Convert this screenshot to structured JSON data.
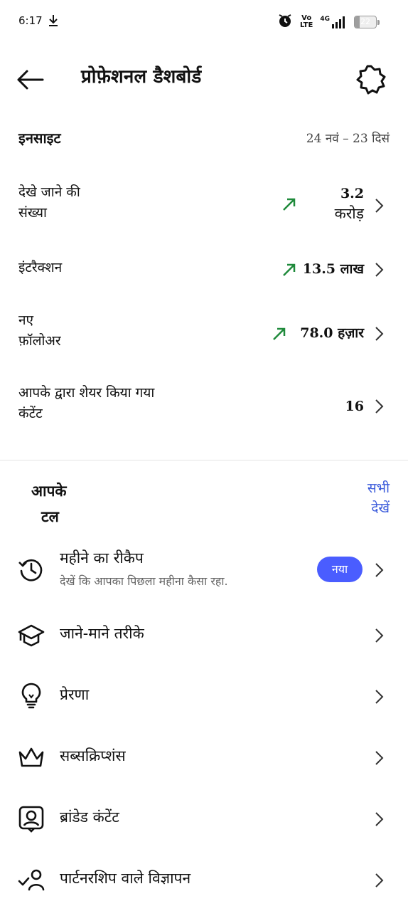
{
  "status_bar": {
    "time": "6:17",
    "network_top": "Vo",
    "network_bottom": "LTE",
    "signal_label": "4G",
    "battery_level": "22"
  },
  "header": {
    "title": "प्रोफ़ेशनल डैशबोर्ड"
  },
  "insights": {
    "title": "इनसाइट",
    "date_range": "24 नवं – 23 दिसं",
    "metrics": [
      {
        "label_line1": "देखे जाने की",
        "label_line2": "संख्या",
        "value_line1": "3.2",
        "value_line2": "करोड़",
        "trend": "up"
      },
      {
        "label_line1": "इंटरैक्शन",
        "value": "13.5 लाख",
        "trend": "up"
      },
      {
        "label_line1": "नए",
        "label_line2": "फ़ॉलोअर",
        "value": "78.0 हज़ार",
        "trend": "up"
      },
      {
        "label_line1": "आपके द्वारा शेयर किया गया",
        "label_line2": "कंटेंट",
        "value": "16",
        "trend": "none"
      }
    ]
  },
  "tools": {
    "title_line1": "आपके",
    "title_line2": "टल",
    "see_all_line1": "सभी",
    "see_all_line2": "देखें",
    "items": [
      {
        "label": "महीने का रीकैप",
        "subtitle": "देखें कि आपका पिछला महीना कैसा रहा.",
        "badge": "नया",
        "icon": "history-icon"
      },
      {
        "label": "जाने-माने तरीके",
        "icon": "graduation-cap-icon"
      },
      {
        "label": "प्रेरणा",
        "icon": "lightbulb-icon"
      },
      {
        "label": "सब्सक्रिप्शंस",
        "icon": "crown-icon"
      },
      {
        "label": "ब्रांडेड कंटेंट",
        "icon": "branded-content-icon"
      },
      {
        "label": "पार्टनरशिप वाले विज्ञापन",
        "icon": "partnership-icon"
      }
    ]
  },
  "colors": {
    "accent": "#4a5dff",
    "link": "#3b5bdb",
    "trend_up": "#1f8a3b"
  }
}
